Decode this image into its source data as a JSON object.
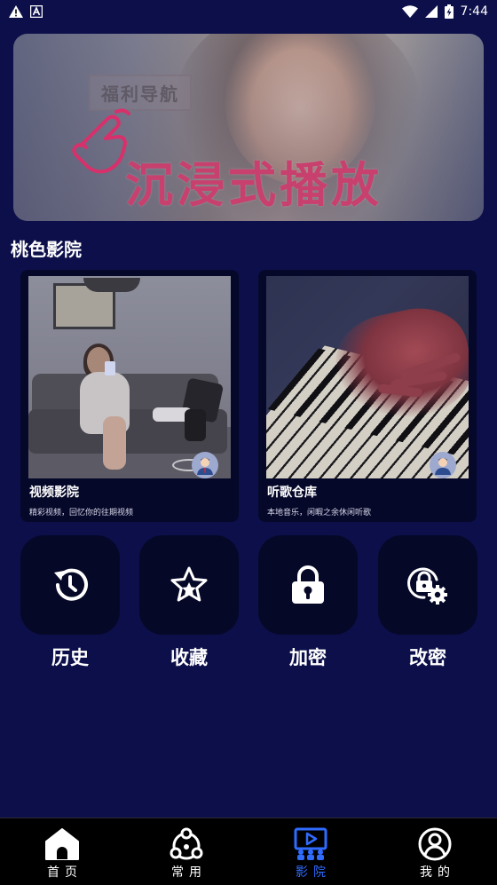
{
  "status_bar": {
    "time": "7:44",
    "icons": [
      "warning-icon",
      "a-badge-icon",
      "wifi-icon",
      "signal-icon",
      "battery-icon"
    ]
  },
  "banner": {
    "badge": "福利导航",
    "title": "沉浸式播放",
    "hand_icon": "pointing-hand-icon"
  },
  "section": {
    "title": "桃色影院"
  },
  "cards": [
    {
      "title": "视频影院",
      "subtitle": "精彩视频，回忆你的往期视频",
      "avatar_icon": "user-avatar-icon"
    },
    {
      "title": "听歌仓库",
      "subtitle": "本地音乐，闲暇之余休闲听歌",
      "avatar_icon": "user-avatar-icon"
    }
  ],
  "actions": [
    {
      "label": "历史",
      "icon": "history-icon"
    },
    {
      "label": "收藏",
      "icon": "star-icon"
    },
    {
      "label": "加密",
      "icon": "lock-icon"
    },
    {
      "label": "改密",
      "icon": "lock-settings-icon"
    }
  ],
  "bottom_nav": [
    {
      "label": "首页",
      "icon": "home-icon",
      "active": false
    },
    {
      "label": "常用",
      "icon": "network-icon",
      "active": false
    },
    {
      "label": "影院",
      "icon": "cinema-icon",
      "active": true
    },
    {
      "label": "我的",
      "icon": "profile-icon",
      "active": false
    }
  ],
  "colors": {
    "background": "#0c0f4a",
    "card": "#06082a",
    "accent": "#2f6bff",
    "banner_title": "#c8406e"
  }
}
